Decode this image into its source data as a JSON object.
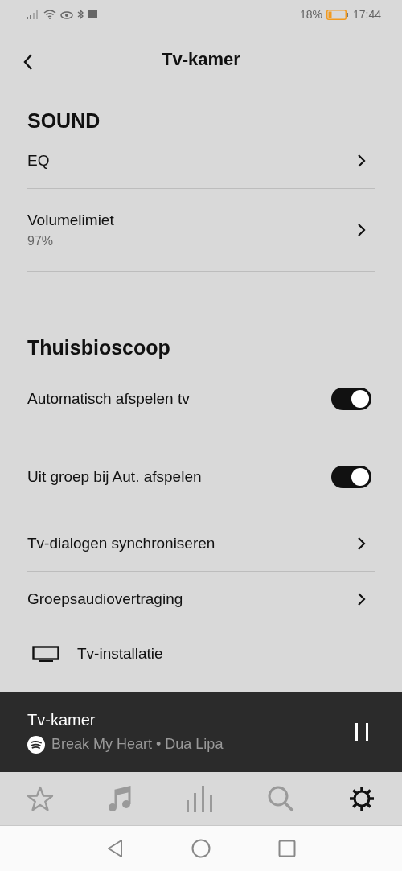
{
  "status_bar": {
    "battery": "18%",
    "time": "17:44"
  },
  "header": {
    "title": "Tv-kamer"
  },
  "sections": [
    {
      "title": "SOUND",
      "items": [
        {
          "kind": "link",
          "label": "EQ"
        },
        {
          "kind": "link",
          "label": "Volumelimiet",
          "value": "97%"
        }
      ]
    },
    {
      "title": "Thuisbioscoop",
      "items": [
        {
          "kind": "toggle",
          "label": "Automatisch afspelen tv",
          "on": true
        },
        {
          "kind": "toggle",
          "label": "Uit groep bij Aut. afspelen",
          "on": true
        },
        {
          "kind": "link",
          "label": "Tv-dialogen synchroniseren"
        },
        {
          "kind": "link",
          "label": "Groepsaudiovertraging"
        },
        {
          "kind": "device",
          "label": "Tv-installatie"
        }
      ]
    }
  ],
  "now_playing": {
    "room": "Tv-kamer",
    "track": "Break My Heart • Dua Lipa",
    "playing": true
  },
  "tabs": [
    {
      "kind": "star",
      "selected": false
    },
    {
      "kind": "music",
      "selected": false
    },
    {
      "kind": "rooms",
      "selected": false
    },
    {
      "kind": "search",
      "selected": false
    },
    {
      "kind": "settings",
      "selected": true
    }
  ]
}
